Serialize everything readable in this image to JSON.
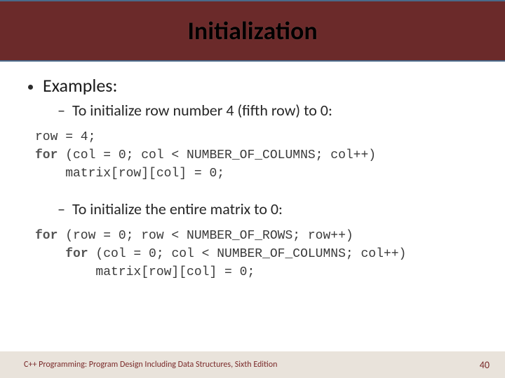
{
  "slide": {
    "title": "Initialization",
    "bullets": {
      "l1": "Examples:",
      "sub1": "To initialize row number 4 (fifth row) to 0:",
      "sub2": "To initialize the entire matrix to 0:"
    },
    "code": {
      "snippet1": {
        "line1_pre": "row = 4;",
        "line2_keyword": "for",
        "line2_rest": " (col = 0; col < NUMBER_OF_COLUMNS; col++)",
        "line3": "    matrix[row][col] = 0;"
      },
      "snippet2": {
        "line1_keyword": "for",
        "line1_rest": " (row = 0; row < NUMBER_OF_ROWS; row++)",
        "line2_indent": "    ",
        "line2_keyword": "for",
        "line2_rest": " (col = 0; col < NUMBER_OF_COLUMNS; col++)",
        "line3": "        matrix[row][col] = 0;"
      }
    },
    "footer": {
      "text": "C++ Programming: Program Design Including Data Structures, Sixth Edition",
      "page": "40"
    }
  }
}
